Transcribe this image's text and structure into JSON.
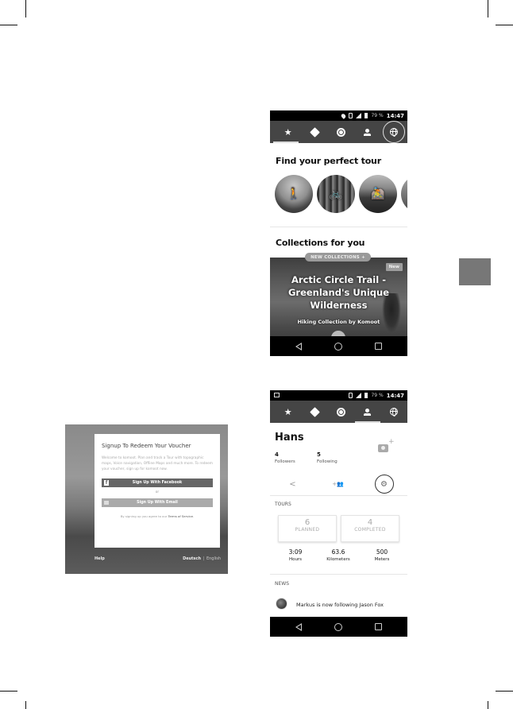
{
  "screen1": {
    "statusbar": {
      "battery": "79 %",
      "time": "14:47"
    },
    "nav_tabs": [
      {
        "name": "favorites",
        "icon": "star-icon",
        "glyph": "★"
      },
      {
        "name": "route",
        "icon": "route-diamond-icon"
      },
      {
        "name": "record",
        "icon": "record-icon"
      },
      {
        "name": "profile",
        "icon": "person-icon"
      },
      {
        "name": "discover",
        "icon": "globe-icon",
        "highlighted": true
      }
    ],
    "find_title": "Find your perfect tour",
    "sports": [
      {
        "name": "hiking",
        "icon": "hiking-icon",
        "glyph": "🚶"
      },
      {
        "name": "cycling",
        "icon": "bicycle-icon",
        "glyph": "🚲"
      },
      {
        "name": "mountain-biking",
        "icon": "mountain-bike-icon",
        "glyph": "🚵"
      },
      {
        "name": "more",
        "icon": "more-sport-icon",
        "glyph": ""
      }
    ],
    "collections_title": "Collections for you",
    "new_collections_pill": "NEW COLLECTIONS +",
    "collection": {
      "badge": "New",
      "title_lines": [
        "Arctic Circle Trail -",
        "Greenland's Unique",
        "Wilderness"
      ],
      "subtitle": "Hiking Collection by Komoot"
    }
  },
  "screen2": {
    "statusbar": {
      "battery": "79 %",
      "time": "14:47"
    },
    "profile": {
      "name": "Hans",
      "followers_count": "4",
      "followers_label": "Followers",
      "following_count": "5",
      "following_label": "Following",
      "camera_plus": "+"
    },
    "actions": [
      {
        "name": "share",
        "icon": "share-icon",
        "glyph": "<"
      },
      {
        "name": "add-friends",
        "icon": "add-friends-icon",
        "glyph": "+👥"
      },
      {
        "name": "settings",
        "icon": "gear-icon",
        "glyph": "⚙",
        "highlighted": true
      }
    ],
    "tours_label": "TOURS",
    "tour_cards": [
      {
        "count": "6",
        "label": "PLANNED"
      },
      {
        "count": "4",
        "label": "COMPLETED"
      }
    ],
    "metrics": [
      {
        "value": "3:09",
        "unit": "Hours"
      },
      {
        "value": "63.6",
        "unit": "Kilometers"
      },
      {
        "value": "500",
        "unit": "Meters"
      }
    ],
    "news_label": "NEWS",
    "news_item": "Markus is now following Jason Fox"
  },
  "signup": {
    "title": "Signup To Redeem Your Voucher",
    "description": "Welcome to komoot. Plan and track a Tour with topographic maps, Voice navigation, Offline Maps and much more. To redeem your voucher, sign up for komoot now.",
    "facebook_button": "Sign Up With Facebook",
    "or_label": "or",
    "email_button": "Sign Up With Email",
    "terms_prefix": "By signing up you agree to our ",
    "terms_link": "Terms of Service",
    "terms_suffix": ".",
    "help_link": "Help",
    "lang_active": "Deutsch",
    "lang_sep": "|",
    "lang_other": "English"
  }
}
